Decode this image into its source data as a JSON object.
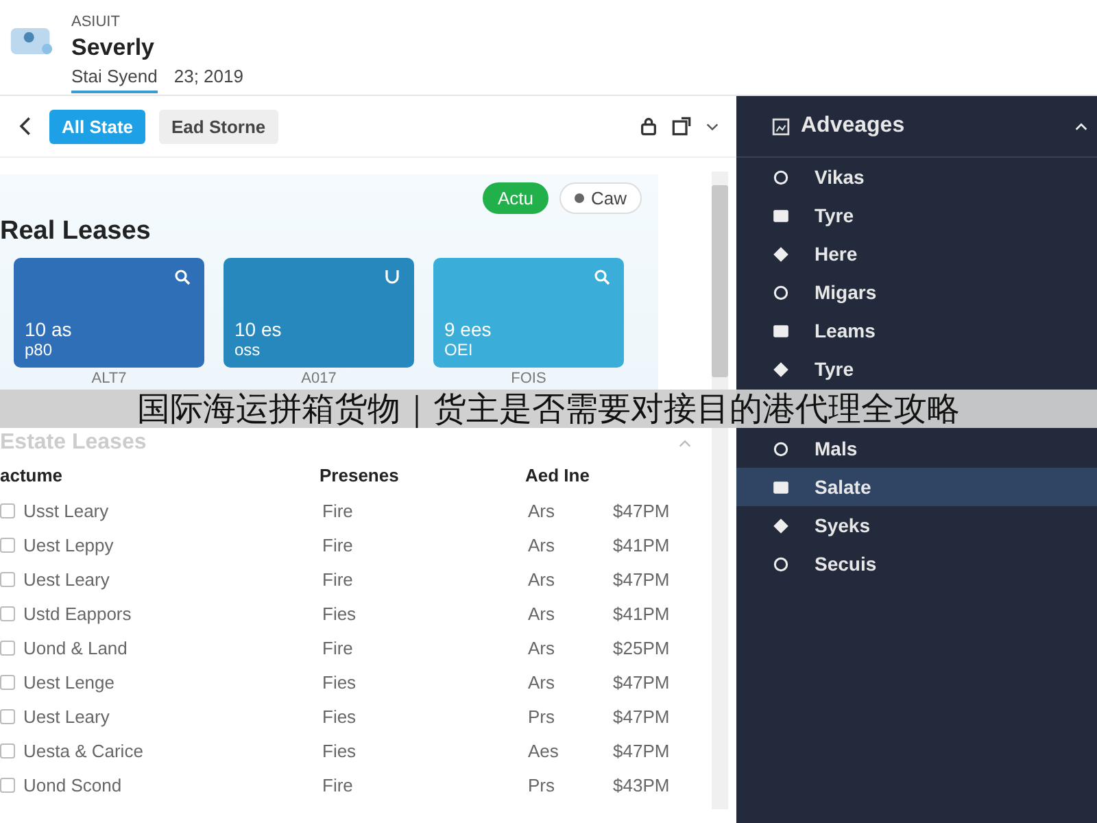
{
  "header": {
    "overline": "ASIUIT",
    "title": "Severly",
    "tab": "Stai Syend",
    "date": "23; 2019"
  },
  "toolbar": {
    "tabs": [
      {
        "label": "All State",
        "selected": true
      },
      {
        "label": "Ead Storne",
        "selected": false
      }
    ]
  },
  "filters": [
    {
      "label": "Actu",
      "selected": true
    },
    {
      "label": "Caw",
      "selected": false
    }
  ],
  "section_title": "Real Leases",
  "cards": [
    {
      "value": "10 as",
      "sub": "p80",
      "caption": "ALT7",
      "color": "#2f6fb8"
    },
    {
      "value": "10 es",
      "sub": "oss",
      "caption": "A017",
      "color": "#2688bd"
    },
    {
      "value": "9 ees",
      "sub": "OEI",
      "caption": "FOIS",
      "color": "#3aaed8"
    }
  ],
  "table": {
    "title": "Estate Leases",
    "columns": [
      "actume",
      "Presenes",
      "Aed Ine"
    ],
    "rows": [
      {
        "checked": false,
        "cells": [
          "Usst Leary",
          "Fire",
          "Ars",
          "$47PM"
        ]
      },
      {
        "checked": false,
        "cells": [
          "Uest Leppy",
          "Fire",
          "Ars",
          "$41PM"
        ]
      },
      {
        "checked": false,
        "cells": [
          "Uest Leary",
          "Fire",
          "Ars",
          "$47PM"
        ]
      },
      {
        "checked": false,
        "cells": [
          "Ustd Eappors",
          "Fies",
          "Ars",
          "$41PM"
        ]
      },
      {
        "checked": false,
        "cells": [
          "Uond & Land",
          "Fire",
          "Ars",
          "$25PM"
        ]
      },
      {
        "checked": false,
        "cells": [
          "Uest Lenge",
          "Fies",
          "Ars",
          "$47PM"
        ]
      },
      {
        "checked": false,
        "cells": [
          "Uest Leary",
          "Fies",
          "Prs",
          "$47PM"
        ]
      },
      {
        "checked": false,
        "cells": [
          "Uesta & Carice",
          "Fies",
          "Aes",
          "$47PM"
        ]
      },
      {
        "checked": false,
        "cells": [
          "Uond Scond",
          "Fire",
          "Prs",
          "$43PM"
        ]
      }
    ]
  },
  "sidebar": {
    "title": "Adveages",
    "items": [
      {
        "label": "Vikas",
        "selected": false
      },
      {
        "label": "Tyre",
        "selected": false
      },
      {
        "label": "Here",
        "selected": false
      },
      {
        "label": "Migars",
        "selected": false
      },
      {
        "label": "Leams",
        "selected": false
      },
      {
        "label": "Tyre",
        "selected": false
      },
      {
        "label": "Mals",
        "selected": false
      },
      {
        "label": "Salate",
        "selected": true
      },
      {
        "label": "Syeks",
        "selected": false
      },
      {
        "label": "Secuis",
        "selected": false
      }
    ]
  },
  "banner": {
    "text": "国际海运拼箱货物｜货主是否需要对接目的港代理全攻略"
  }
}
